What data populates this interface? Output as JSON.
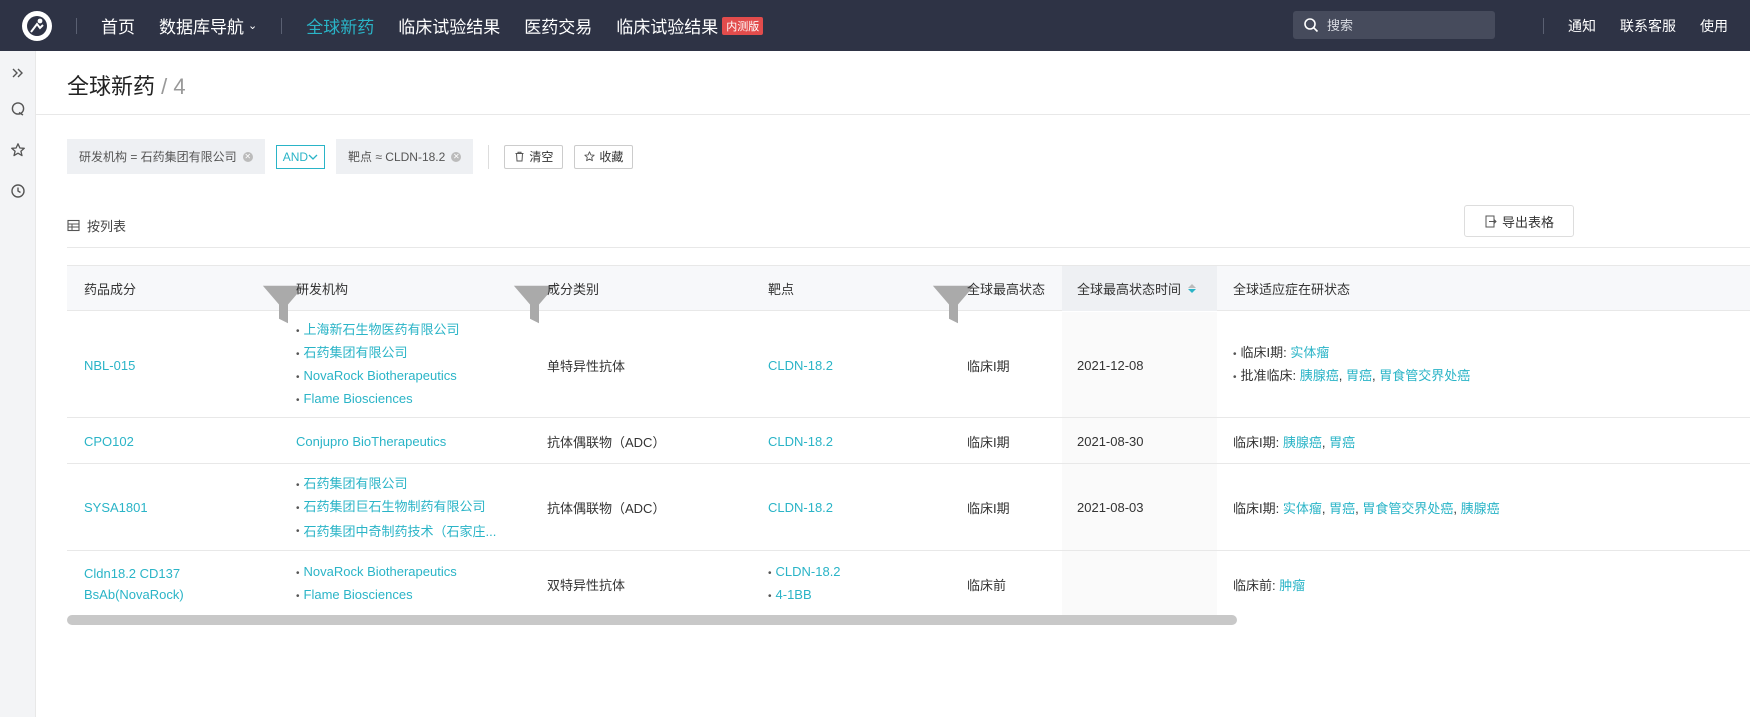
{
  "topbar": {
    "logo": "logo-icon",
    "nav": [
      {
        "label": "首页",
        "active": false
      },
      {
        "label": "数据库导航",
        "active": false,
        "dropdown": true
      },
      {
        "label": "全球新药",
        "active": true
      },
      {
        "label": "临床试验结果",
        "active": false
      },
      {
        "label": "医药交易",
        "active": false
      },
      {
        "label": "临床试验结果",
        "active": false,
        "badge": "内测版"
      }
    ],
    "search_placeholder": "搜索",
    "links": [
      "通知",
      "联系客服",
      "使用"
    ]
  },
  "sidebar": {
    "icons": [
      "expand-icon",
      "chat-icon",
      "star-icon",
      "history-icon"
    ]
  },
  "page": {
    "title": "全球新药",
    "separator": "/",
    "count": "4"
  },
  "filters": {
    "chips": [
      {
        "text": "研发机构 = 石药集团有限公司"
      },
      {
        "text": "靶点 ≈ CLDN-18.2"
      }
    ],
    "operator": "AND",
    "clear_label": "清空",
    "save_label": "收藏"
  },
  "view": {
    "label": "按列表",
    "export_label": "导出表格"
  },
  "table": {
    "columns": [
      "药品成分",
      "研发机构",
      "成分类别",
      "靶点",
      "全球最高状态",
      "全球最高状态时间",
      "全球适应症在研状态"
    ],
    "rows": [
      {
        "drug": "NBL-015",
        "orgs": [
          "上海新石生物医药有限公司",
          "石药集团有限公司",
          "NovaRock Biotherapeutics",
          "Flame Biosciences"
        ],
        "category": "单特异性抗体",
        "targets": [
          "CLDN-18.2"
        ],
        "status": "临床I期",
        "date": "2021-12-08",
        "indications": [
          {
            "stage": "临床I期",
            "items": [
              "实体瘤"
            ]
          },
          {
            "stage": "批准临床",
            "items": [
              "胰腺癌",
              "胃癌",
              "胃食管交界处癌"
            ]
          }
        ]
      },
      {
        "drug": "CPO102",
        "orgs": [
          "Conjupro BioTherapeutics"
        ],
        "category": "抗体偶联物（ADC）",
        "targets": [
          "CLDN-18.2"
        ],
        "status": "临床I期",
        "date": "2021-08-30",
        "indications": [
          {
            "stage": "临床I期",
            "items": [
              "胰腺癌",
              "胃癌"
            ]
          }
        ]
      },
      {
        "drug": "SYSA1801",
        "orgs": [
          "石药集团有限公司",
          "石药集团巨石生物制药有限公司",
          "石药集团中奇制药技术（石家庄..."
        ],
        "category": "抗体偶联物（ADC）",
        "targets": [
          "CLDN-18.2"
        ],
        "status": "临床I期",
        "date": "2021-08-03",
        "indications": [
          {
            "stage": "临床I期",
            "items": [
              "实体瘤",
              "胃癌",
              "胃食管交界处癌",
              "胰腺癌"
            ]
          }
        ]
      },
      {
        "drug": "Cldn18.2 CD137 BsAb(NovaRock)",
        "orgs": [
          "NovaRock Biotherapeutics",
          "Flame Biosciences"
        ],
        "category": "双特异性抗体",
        "targets": [
          "CLDN-18.2",
          "4-1BB"
        ],
        "status": "临床前",
        "date": "",
        "indications": [
          {
            "stage": "临床前",
            "items": [
              "肿瘤"
            ]
          }
        ]
      }
    ]
  },
  "colors": {
    "topbar_bg": "#2e3345",
    "accent": "#2ab4c7",
    "badge": "#e24c4c"
  }
}
